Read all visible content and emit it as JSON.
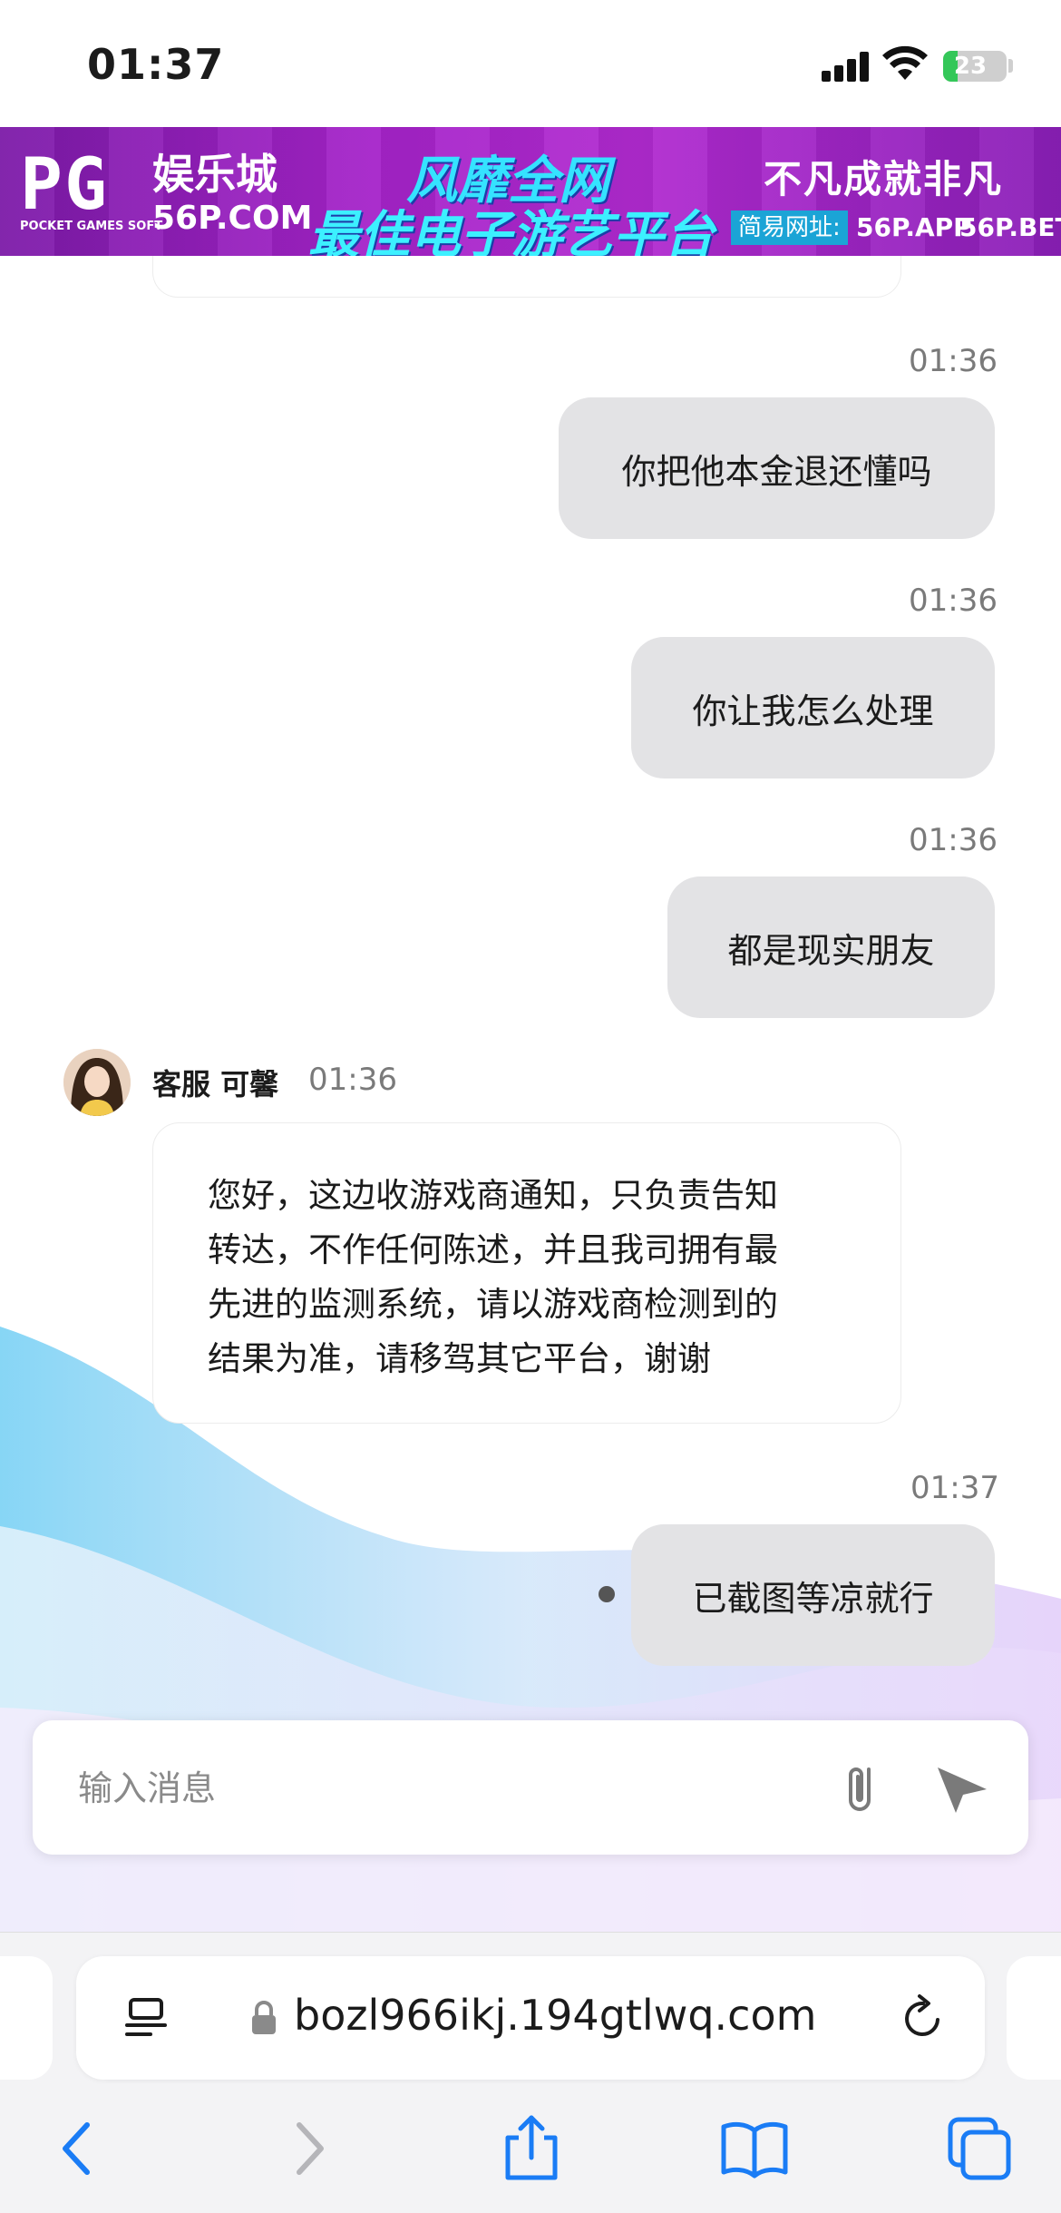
{
  "status_bar": {
    "time": "01:37",
    "battery": "23",
    "battery_level_pct": 23,
    "icons": [
      "cellular-signal-icon",
      "wifi-icon",
      "battery-charging-icon"
    ]
  },
  "ad_banner": {
    "logo": "PG",
    "logo_sub": "POCKET GAMES SOFT",
    "brand": "娱乐城",
    "domain": "56P.COM",
    "slogan_line1": "风靡全网",
    "slogan_line2": "最佳电子游艺平台",
    "right_title": "不凡成就非凡",
    "address_label": "简易网址:",
    "address_1": "56P.APP",
    "address_2": "56P.BET"
  },
  "messages": [
    {
      "time": "01:36",
      "text": "你把他本金退还懂吗"
    },
    {
      "time": "01:36",
      "text": "你让我怎么处理"
    },
    {
      "time": "01:36",
      "text": "都是现实朋友"
    },
    {
      "time": "01:37",
      "text": "已截图等凉就行"
    }
  ],
  "agent_message": {
    "name": "客服 可馨",
    "time": "01:36",
    "lines": [
      "您好，这边收游戏商通知，只负责告知",
      "转达，不作任何陈述，并且我司拥有最",
      "先进的监测系统，请以游戏商检测到的",
      "结果为准，请移驾其它平台，谢谢"
    ]
  },
  "composer": {
    "placeholder": "输入消息",
    "value": ""
  },
  "browser": {
    "url": "bozl966ikj.194gtlwq.com"
  },
  "colors": {
    "bubble_out": "#e3e3e5",
    "ad_purple": "#a523c9",
    "ad_cyan": "#35e3ff",
    "ios_blue": "#1a7cf5"
  }
}
